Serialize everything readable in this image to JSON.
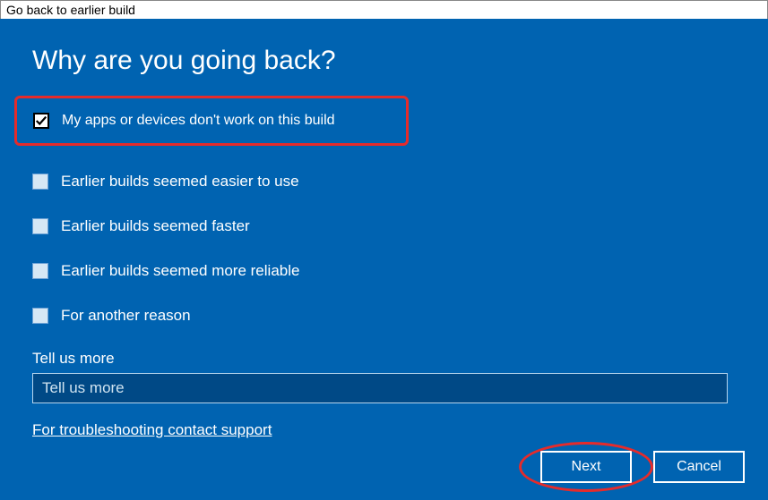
{
  "titlebar": "Go back to earlier build",
  "heading": "Why are you going back?",
  "options": [
    {
      "label": "My apps or devices don't work on this build",
      "checked": true,
      "highlighted": true
    },
    {
      "label": "Earlier builds seemed easier to use",
      "checked": false,
      "highlighted": false
    },
    {
      "label": "Earlier builds seemed faster",
      "checked": false,
      "highlighted": false
    },
    {
      "label": "Earlier builds seemed more reliable",
      "checked": false,
      "highlighted": false
    },
    {
      "label": "For another reason",
      "checked": false,
      "highlighted": false
    }
  ],
  "tell_more": {
    "label": "Tell us more",
    "placeholder": "Tell us more",
    "value": ""
  },
  "support_link": "For troubleshooting contact support",
  "buttons": {
    "next": "Next",
    "cancel": "Cancel"
  },
  "annotation": {
    "next_circled": true
  }
}
